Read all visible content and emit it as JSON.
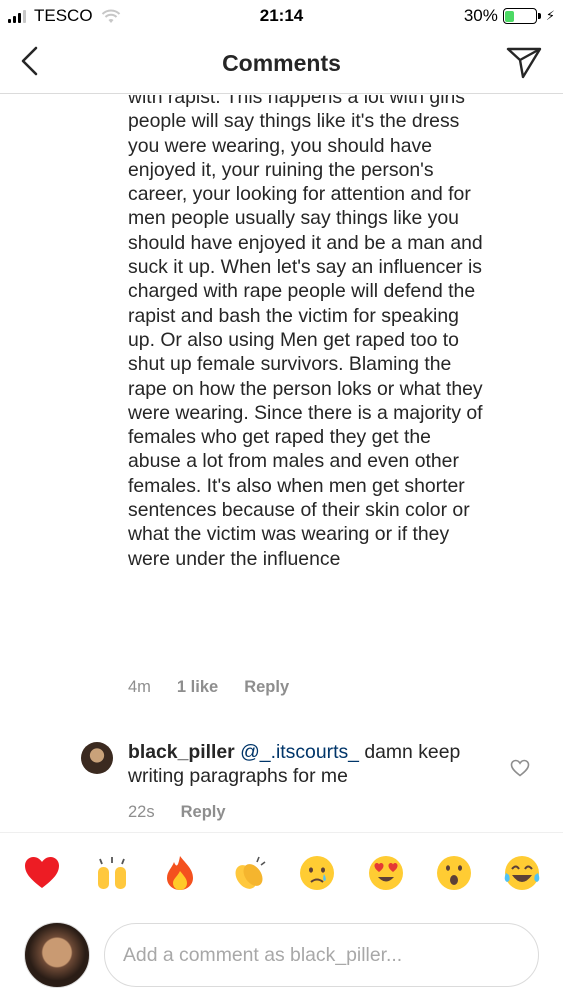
{
  "status_bar": {
    "carrier": "TESCO",
    "time": "21:14",
    "battery_percent": "30%",
    "battery_level": 0.3
  },
  "nav": {
    "title": "Comments",
    "back_icon": "chevron-left-icon",
    "send_icon": "paper-plane-icon"
  },
  "comments": [
    {
      "text": "with rapist. This happens a lot with girls people will say things like it's the dress you were wearing, you should have enjoyed it, your ruining the person's career, your looking for attention and for men people usually say things like you should have enjoyed it and be a man and suck it up. When let's say an influencer is charged with rape people will defend the rapist and bash the victim for speaking up. Or also using Men get raped too to shut up female survivors. Blaming the rape on how the person loks or what they were wearing. Since there is a majority of females who get raped they get the abuse a lot from males and even other females. It's also when men get shorter sentences because of their skin color or what the victim was wearing or if they were under the influence",
      "time": "4m",
      "likes": "1 like",
      "reply": "Reply"
    },
    {
      "username": "black_piller",
      "mention": "@_.itscourts_",
      "text": " damn keep writing paragraphs for me",
      "time": "22s",
      "reply": "Reply"
    }
  ],
  "emoji_bar": [
    "heart",
    "raising-hands",
    "fire",
    "clapping-hands",
    "crying-face",
    "heart-eyes-face",
    "surprised-face",
    "tears-of-joy-face"
  ],
  "composer": {
    "placeholder": "Add a comment as black_piller..."
  },
  "colors": {
    "text": "#262626",
    "meta": "#8e8e8e",
    "mention": "#003569",
    "battery": "#4cd964",
    "border": "#dbdbdb"
  }
}
